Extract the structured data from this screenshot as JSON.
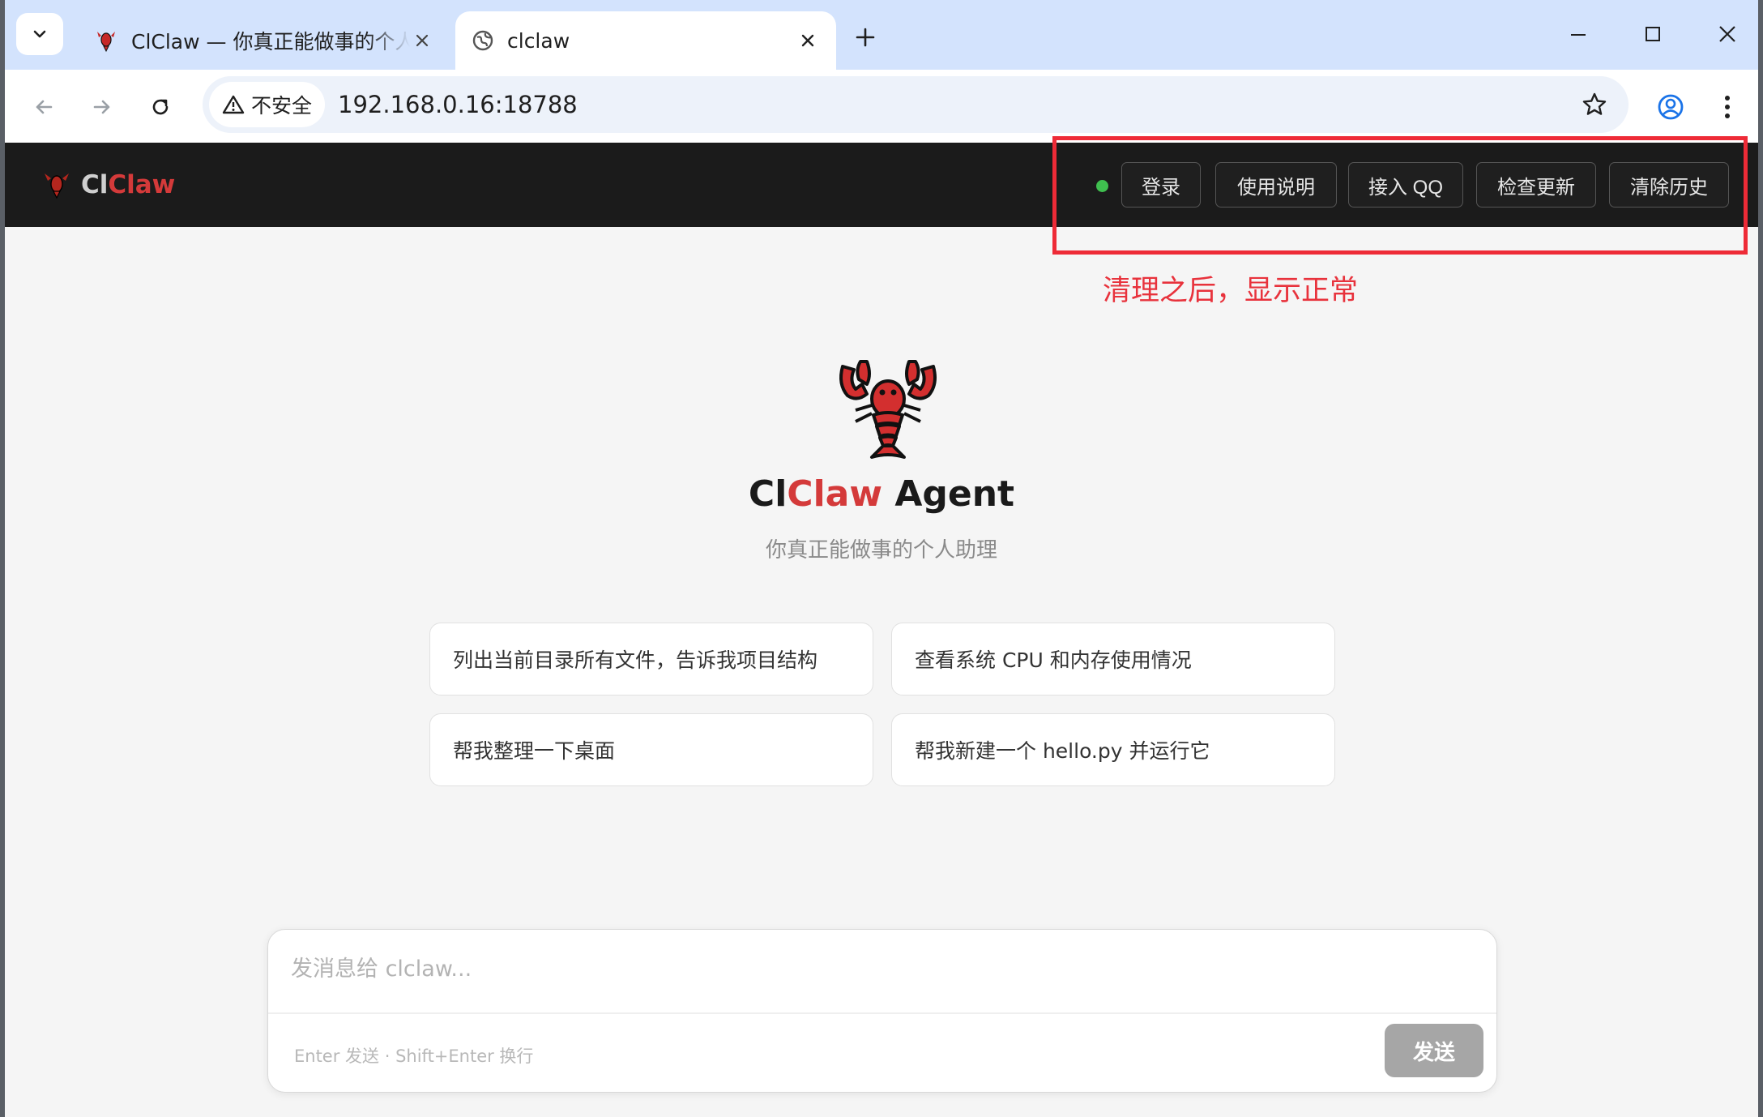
{
  "browser": {
    "tabs": [
      {
        "title": "ClClaw — 你真正能做事的个人助理",
        "active": false
      },
      {
        "title": "clclaw",
        "active": true
      }
    ],
    "security_label": "不安全",
    "url": "192.168.0.16:18788"
  },
  "header": {
    "brand_part1": "Cl",
    "brand_part2": "Claw",
    "status_color": "#3fbf4f",
    "buttons": {
      "login": "登录",
      "guide": "使用说明",
      "qq": "接入 QQ",
      "update": "检查更新",
      "clear": "清除历史"
    }
  },
  "annotation": {
    "text": "清理之后，显示正常",
    "color": "#ee2b37"
  },
  "hero": {
    "title_part1": "Cl",
    "title_part2": "Claw",
    "title_part3": " Agent",
    "subtitle": "你真正能做事的个人助理"
  },
  "suggestions": [
    "列出当前目录所有文件，告诉我项目结构",
    "查看系统 CPU 和内存使用情况",
    "帮我整理一下桌面",
    "帮我新建一个 hello.py 并运行它"
  ],
  "composer": {
    "placeholder": "发消息给 clclaw...",
    "hint": "Enter 发送 · Shift+Enter 换行",
    "send_label": "发送"
  },
  "colors": {
    "brand_red": "#d43a3a",
    "header_bg": "#1b1b1b"
  }
}
